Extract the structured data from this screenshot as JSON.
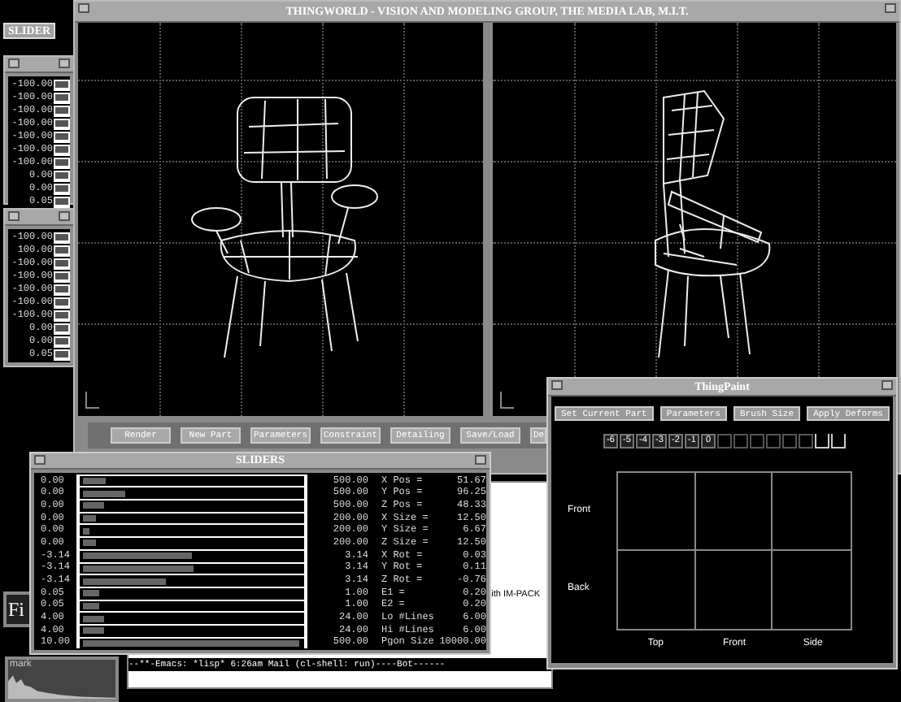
{
  "desktop_label": "SLIDER",
  "small_slider_windows": [
    {
      "values": [
        "-100.00",
        "-100.00",
        "-100.00",
        "-100.00",
        "-100.00",
        "-100.00",
        "-100.00",
        "0.00",
        "0.00",
        "0.05"
      ]
    },
    {
      "values": [
        "-100.00",
        "100.00",
        "-100.00",
        "-100.00",
        "-100.00",
        "-100.00",
        "-100.00",
        "0.00",
        "0.00",
        "0.05"
      ]
    }
  ],
  "main_window": {
    "title": "THINGWORLD - VISION AND MODELING GROUP, THE MEDIA LAB, M.I.T.",
    "toolbar": [
      "Render",
      "New Part",
      "Parameters",
      "Constraint",
      "Detailing",
      "Save/Load",
      "De"
    ]
  },
  "sliders_window": {
    "title": "SLIDERS",
    "rows": [
      {
        "min": "0.00",
        "max": "500.00",
        "label": "X Pos =",
        "value": "51.67",
        "level": 0.11
      },
      {
        "min": "0.00",
        "max": "500.00",
        "label": "Y Pos =",
        "value": "96.25",
        "level": 0.2
      },
      {
        "min": "0.00",
        "max": "500.00",
        "label": "Z Pos =",
        "value": "48.33",
        "level": 0.1
      },
      {
        "min": "0.00",
        "max": "200.00",
        "label": "X Size =",
        "value": "12.50",
        "level": 0.06
      },
      {
        "min": "0.00",
        "max": "200.00",
        "label": "Y Size =",
        "value": "6.67",
        "level": 0.03
      },
      {
        "min": "0.00",
        "max": "200.00",
        "label": "Z Size =",
        "value": "12.50",
        "level": 0.06
      },
      {
        "min": "-3.14",
        "max": "3.14",
        "label": "X Rot =",
        "value": "0.03",
        "level": 0.5
      },
      {
        "min": "-3.14",
        "max": "3.14",
        "label": "Y Rot =",
        "value": "0.11",
        "level": 0.51
      },
      {
        "min": "-3.14",
        "max": "3.14",
        "label": "Z Rot =",
        "value": "-0.76",
        "level": 0.38
      },
      {
        "min": "0.05",
        "max": "1.00",
        "label": "E1 =",
        "value": "0.20",
        "level": 0.08
      },
      {
        "min": "0.05",
        "max": "1.00",
        "label": "E2 =",
        "value": "0.20",
        "level": 0.08
      },
      {
        "min": "4.00",
        "max": "24.00",
        "label": "Lo #Lines",
        "value": "6.00",
        "level": 0.1
      },
      {
        "min": "4.00",
        "max": "24.00",
        "label": "Hi #Lines",
        "value": "6.00",
        "level": 0.1
      },
      {
        "min": "10.00",
        "max": "500.00",
        "label": "Pgon Size",
        "value": "10000.00",
        "level": 0.99
      }
    ]
  },
  "emacs": {
    "text": "ith IM-PACK",
    "mode_line": "--**-Emacs: *lisp*        6:26am  Mail  (cl-shell: run)----Bot------"
  },
  "fi_label": "Fi",
  "histogram": {
    "label": "mark"
  },
  "thingpaint": {
    "title": "ThingPaint",
    "buttons": [
      "Set Current Part",
      "Parameters",
      "Brush Size",
      "Apply Deforms"
    ],
    "scale": [
      "-6",
      "-5",
      "-4",
      "-3",
      "-2",
      "-1",
      "0"
    ],
    "rows": [
      "Front",
      "Back"
    ],
    "columns": [
      "Top",
      "Front",
      "Side"
    ]
  }
}
